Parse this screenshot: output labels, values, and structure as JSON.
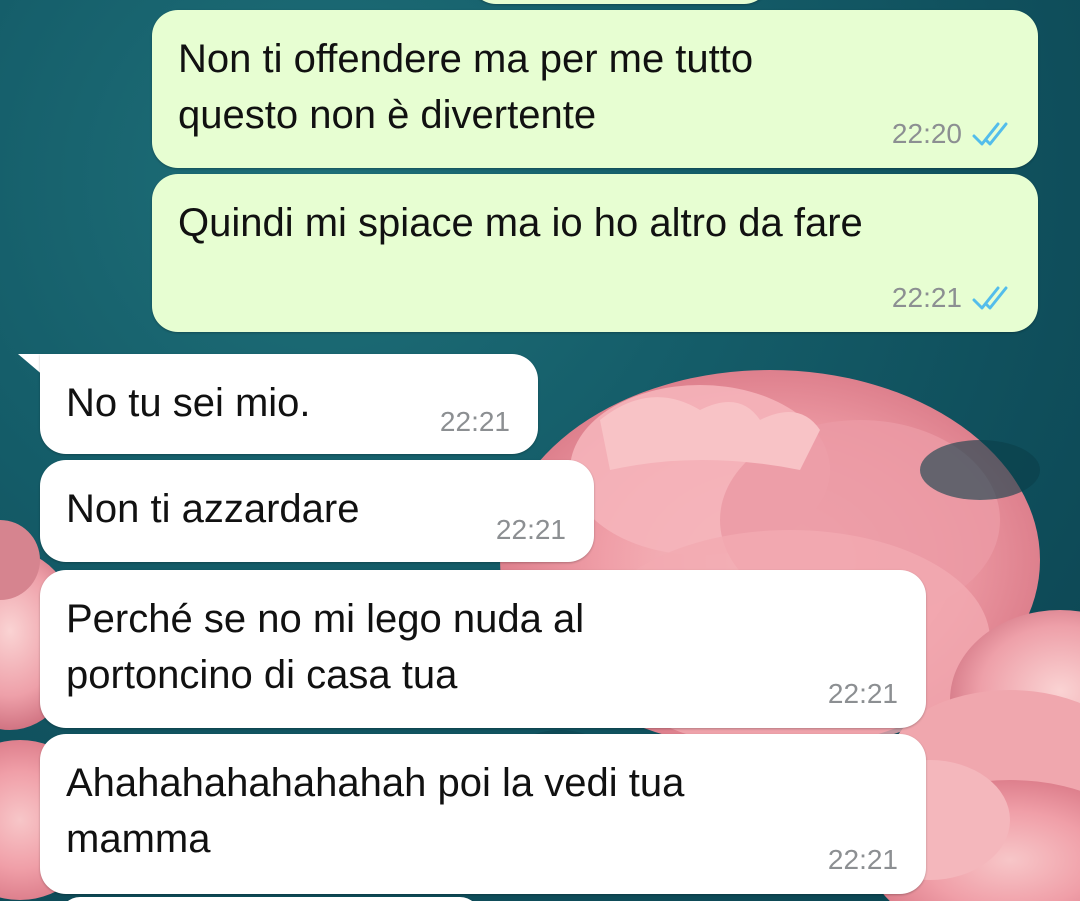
{
  "colors": {
    "outgoing_bubble": "#e7fed2",
    "incoming_bubble": "#ffffff",
    "read_ticks": "#53bdeb",
    "timestamp": "#8c8f92",
    "wallpaper_teal": "#0f4e5b",
    "wallpaper_flowers": "#f2a7b0"
  },
  "messages": [
    {
      "direction": "outgoing",
      "text": "Non ti offendere ma per me tutto\nquesto non è divertente",
      "time": "22:20",
      "status_icon": "double-check-read-icon"
    },
    {
      "direction": "outgoing",
      "text": "Quindi mi spiace ma io ho altro da fare",
      "time": "22:21",
      "status_icon": "double-check-read-icon"
    },
    {
      "direction": "incoming",
      "text": "No tu sei mio.",
      "time": "22:21"
    },
    {
      "direction": "incoming",
      "text": "Non ti azzardare",
      "time": "22:21"
    },
    {
      "direction": "incoming",
      "text": "Perché se no mi lego nuda al\nportoncino di casa tua",
      "time": "22:21"
    },
    {
      "direction": "incoming",
      "text": "Ahahahahahahahah poi la vedi tua\nmamma",
      "time": "22:21"
    }
  ]
}
